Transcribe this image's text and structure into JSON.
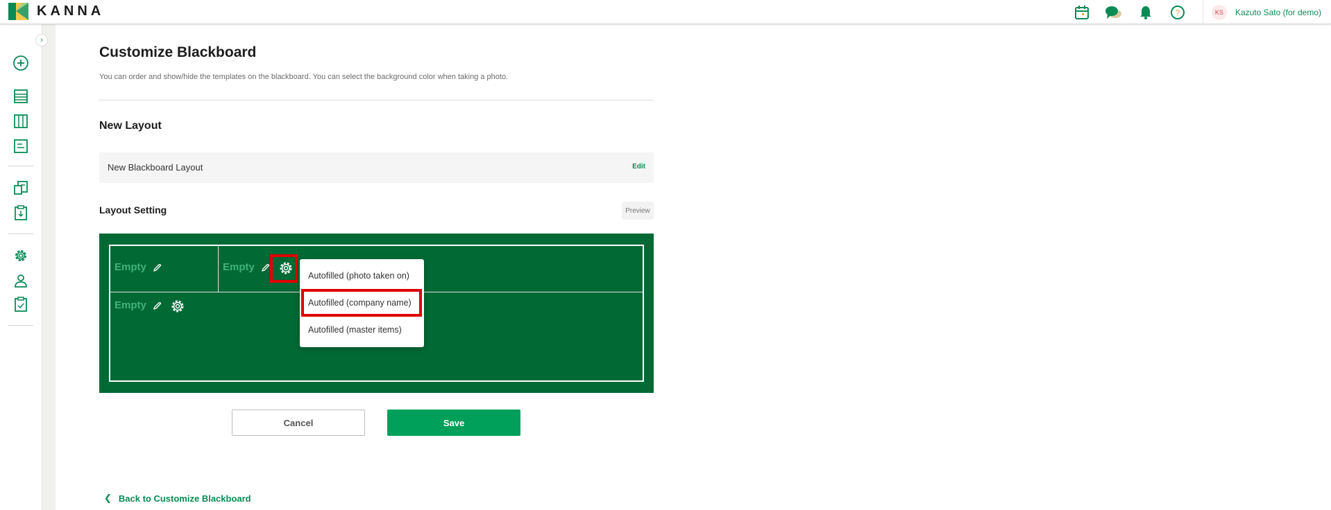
{
  "header": {
    "logo_text": "KANNA",
    "user_initials": "KS",
    "user_name": "Kazuto Sato (for demo)",
    "icons": [
      "calendar-icon",
      "chat-icon",
      "bell-icon",
      "help-icon"
    ]
  },
  "sidebar": {
    "toggle": "›",
    "icons": [
      "add-icon",
      "list-icon",
      "board-icon",
      "report-icon",
      "documents-icon",
      "clipboard-download-icon",
      "settings-icon",
      "user-icon",
      "clipboard-check-icon"
    ]
  },
  "page": {
    "title": "Customize Blackboard",
    "description": "You can order and show/hide the templates on the blackboard. You can select the background color when taking a photo."
  },
  "layout_section": {
    "title": "New Layout",
    "name": "New Blackboard Layout",
    "edit_label": "Edit"
  },
  "layout_setting": {
    "title": "Layout Setting",
    "preview_label": "Preview",
    "board_color": "#006934",
    "cells": [
      {
        "label": "Empty"
      },
      {
        "label": "Empty"
      },
      {
        "label": "Empty"
      }
    ]
  },
  "dropdown": {
    "items": [
      "Autofilled (photo taken on)",
      "Autofilled (company name)",
      "Autofilled (master items)"
    ],
    "highlighted_index": 1
  },
  "actions": {
    "cancel_label": "Cancel",
    "save_label": "Save"
  },
  "back_link": {
    "label": "Back to Customize Blackboard"
  },
  "colors": {
    "brand_green": "#0a8a55",
    "save_green": "#00a05a",
    "highlight_red": "#e00000"
  }
}
